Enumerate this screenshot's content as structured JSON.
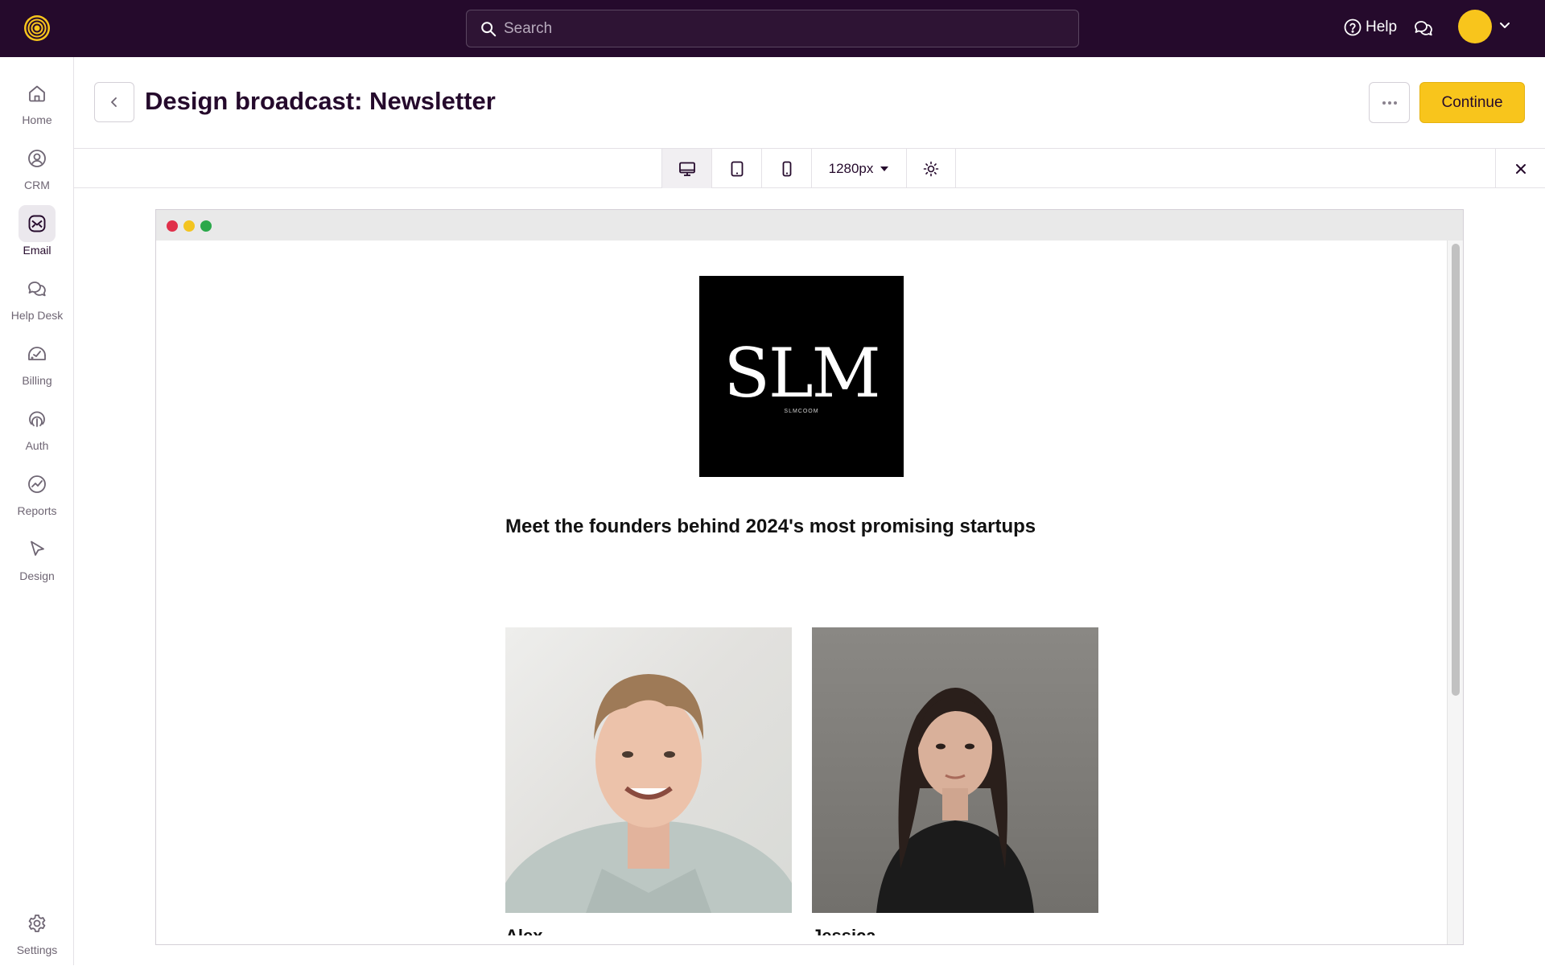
{
  "topbar": {
    "search_placeholder": "Search",
    "help_label": "Help"
  },
  "sidebar": {
    "items": [
      {
        "label": "Home",
        "icon": "home-icon"
      },
      {
        "label": "CRM",
        "icon": "crm-icon"
      },
      {
        "label": "Email",
        "icon": "email-icon",
        "active": true
      },
      {
        "label": "Help Desk",
        "icon": "help-desk-icon"
      },
      {
        "label": "Billing",
        "icon": "billing-icon"
      },
      {
        "label": "Auth",
        "icon": "auth-icon"
      },
      {
        "label": "Reports",
        "icon": "reports-icon"
      },
      {
        "label": "Design",
        "icon": "design-icon"
      }
    ],
    "settings_label": "Settings"
  },
  "header": {
    "title": "Design broadcast: Newsletter",
    "continue_label": "Continue"
  },
  "preview_toolbar": {
    "width_value": "1280px",
    "active_device": "desktop"
  },
  "email": {
    "logo_text": "SLM",
    "logo_subtext": "SLMCOOM",
    "headline": "Meet the founders behind 2024's most promising startups",
    "founders": [
      {
        "caption": "Alex"
      },
      {
        "caption": "Jessica"
      }
    ]
  },
  "colors": {
    "topbar_bg": "#250a2c",
    "accent": "#f8c51c",
    "dot_red": "#e0304a",
    "dot_yellow": "#f3c420",
    "dot_green": "#2aa84a"
  }
}
